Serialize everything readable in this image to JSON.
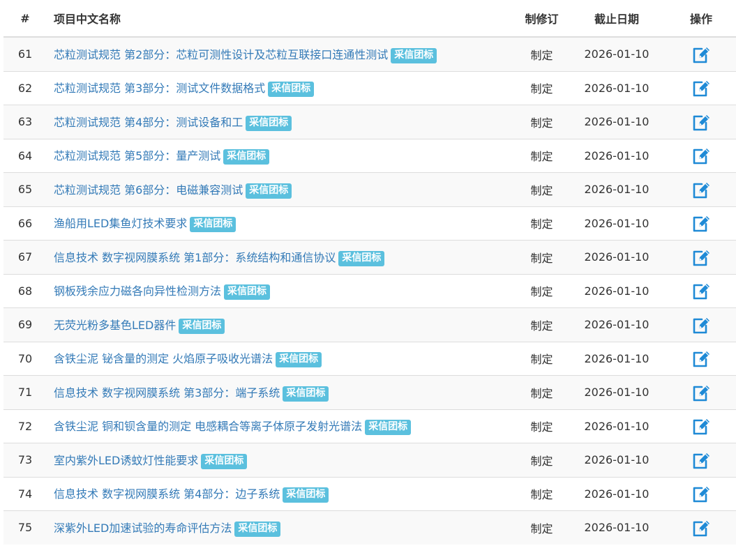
{
  "headers": {
    "num": "#",
    "name": "项目中文名称",
    "type": "制修订",
    "deadline": "截止日期",
    "action": "操作"
  },
  "colors": {
    "link": "#337ab7",
    "badge": "#5bc0de",
    "edit_icon": "#1f8ad6",
    "row_stripe": "#f9f9f9",
    "border": "#dddddd"
  },
  "rows": [
    {
      "num": "61",
      "name": "芯粒测试规范 第2部分：芯粒可测性设计及芯粒互联接口连通性测试",
      "badge": "采信团标",
      "type": "制定",
      "deadline": "2026-01-10",
      "action_icon": "edit-icon"
    },
    {
      "num": "62",
      "name": "芯粒测试规范 第3部分：测试文件数据格式",
      "badge": "采信团标",
      "type": "制定",
      "deadline": "2026-01-10",
      "action_icon": "edit-icon"
    },
    {
      "num": "63",
      "name": "芯粒测试规范 第4部分：测试设备和工",
      "badge": "采信团标",
      "type": "制定",
      "deadline": "2026-01-10",
      "action_icon": "edit-icon"
    },
    {
      "num": "64",
      "name": "芯粒测试规范 第5部分：量产测试",
      "badge": "采信团标",
      "type": "制定",
      "deadline": "2026-01-10",
      "action_icon": "edit-icon"
    },
    {
      "num": "65",
      "name": "芯粒测试规范 第6部分：电磁兼容测试",
      "badge": "采信团标",
      "type": "制定",
      "deadline": "2026-01-10",
      "action_icon": "edit-icon"
    },
    {
      "num": "66",
      "name": "渔船用LED集鱼灯技术要求",
      "badge": "采信团标",
      "type": "制定",
      "deadline": "2026-01-10",
      "action_icon": "edit-icon"
    },
    {
      "num": "67",
      "name": "信息技术 数字视网膜系统 第1部分：系统结构和通信协议",
      "badge": "采信团标",
      "type": "制定",
      "deadline": "2026-01-10",
      "action_icon": "edit-icon"
    },
    {
      "num": "68",
      "name": "钢板残余应力磁各向异性检测方法",
      "badge": "采信团标",
      "type": "制定",
      "deadline": "2026-01-10",
      "action_icon": "edit-icon"
    },
    {
      "num": "69",
      "name": "无荧光粉多基色LED器件",
      "badge": "采信团标",
      "type": "制定",
      "deadline": "2026-01-10",
      "action_icon": "edit-icon"
    },
    {
      "num": "70",
      "name": "含铁尘泥 铋含量的测定 火焰原子吸收光谱法",
      "badge": "采信团标",
      "type": "制定",
      "deadline": "2026-01-10",
      "action_icon": "edit-icon"
    },
    {
      "num": "71",
      "name": "信息技术 数字视网膜系统 第3部分：端子系统",
      "badge": "采信团标",
      "type": "制定",
      "deadline": "2026-01-10",
      "action_icon": "edit-icon"
    },
    {
      "num": "72",
      "name": "含铁尘泥 铜和钡含量的测定 电感耦合等离子体原子发射光谱法",
      "badge": "采信团标",
      "type": "制定",
      "deadline": "2026-01-10",
      "action_icon": "edit-icon"
    },
    {
      "num": "73",
      "name": "室内紫外LED诱蚊灯性能要求",
      "badge": "采信团标",
      "type": "制定",
      "deadline": "2026-01-10",
      "action_icon": "edit-icon"
    },
    {
      "num": "74",
      "name": "信息技术 数字视网膜系统 第4部分：边子系统",
      "badge": "采信团标",
      "type": "制定",
      "deadline": "2026-01-10",
      "action_icon": "edit-icon"
    },
    {
      "num": "75",
      "name": "深紫外LED加速试验的寿命评估方法",
      "badge": "采信团标",
      "type": "制定",
      "deadline": "2026-01-10",
      "action_icon": "edit-icon"
    }
  ]
}
